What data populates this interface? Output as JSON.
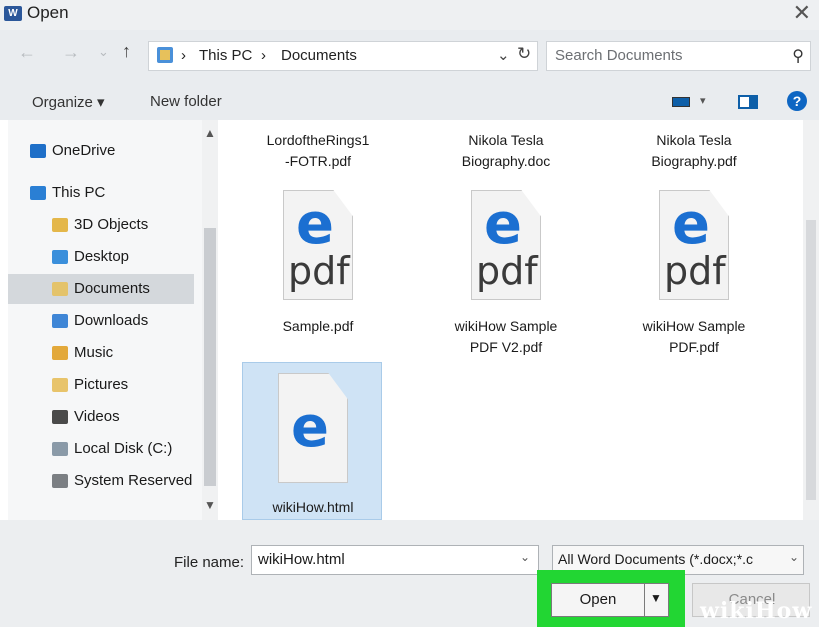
{
  "window": {
    "title": "Open",
    "close_glyph": "✕",
    "app_icon_text": "W"
  },
  "nav": {
    "back_glyph": "←",
    "forward_glyph": "→",
    "recent_glyph": "⌄",
    "up_glyph": "↑",
    "breadcrumb": [
      "›",
      "This PC",
      "›",
      "Documents"
    ],
    "dropdown_glyph": "⌄",
    "refresh_glyph": "↻",
    "search_placeholder": "Search Documents",
    "search_icon_glyph": "⚲"
  },
  "toolbar": {
    "organize_label": "Organize ▾",
    "new_folder_label": "New folder",
    "view_caret": "▾",
    "help_label": "?"
  },
  "sidebar": {
    "scroll_up": "▲",
    "scroll_down": "▼",
    "items": [
      {
        "label": "OneDrive",
        "icon": "cloud-icon",
        "color": "#1e6fc8",
        "selected": false
      },
      {
        "label": "This PC",
        "icon": "computer-icon",
        "color": "#2a7fd4",
        "selected": false
      },
      {
        "label": "3D Objects",
        "icon": "3d-objects-folder-icon",
        "color": "#e4b74a",
        "selected": false
      },
      {
        "label": "Desktop",
        "icon": "desktop-folder-icon",
        "color": "#3a8fdb",
        "selected": false
      },
      {
        "label": "Documents",
        "icon": "documents-folder-icon",
        "color": "#e4c36a",
        "selected": true
      },
      {
        "label": "Downloads",
        "icon": "downloads-folder-icon",
        "color": "#3f86d6",
        "selected": false
      },
      {
        "label": "Music",
        "icon": "music-folder-icon",
        "color": "#e3a93b",
        "selected": false
      },
      {
        "label": "Pictures",
        "icon": "pictures-folder-icon",
        "color": "#e8c46b",
        "selected": false
      },
      {
        "label": "Videos",
        "icon": "videos-folder-icon",
        "color": "#4a4a4a",
        "selected": false
      },
      {
        "label": "Local Disk (C:)",
        "icon": "drive-icon",
        "color": "#8a9aa8",
        "selected": false
      },
      {
        "label": "System Reserved",
        "icon": "drive-icon",
        "color": "#7b7f83",
        "selected": false
      }
    ]
  },
  "files": [
    {
      "name_lines": [
        "LordoftheRings1",
        "-FOTR.pdf"
      ],
      "icon": "edge-pdf-icon"
    },
    {
      "name_lines": [
        "Nikola Tesla",
        "Biography.doc"
      ],
      "icon": "edge-pdf-icon"
    },
    {
      "name_lines": [
        "Nikola Tesla",
        "Biography.pdf"
      ],
      "icon": "edge-pdf-icon"
    },
    {
      "name_lines": [
        "Sample.pdf"
      ],
      "icon": "edge-logo"
    },
    {
      "name_lines": [
        "wikiHow Sample",
        "PDF V2.pdf"
      ],
      "icon": "edge-logo"
    },
    {
      "name_lines": [
        "wikiHow Sample",
        "PDF.pdf"
      ],
      "icon": "edge-logo"
    },
    {
      "name_lines": [
        "wikiHow.html"
      ],
      "icon": "edge-html-icon",
      "selected": true
    }
  ],
  "icon_text": {
    "e": "e",
    "pdf": "pdf"
  },
  "bottom": {
    "file_name_label": "File name:",
    "file_name_value": "wikiHow.html",
    "file_name_chev": "⌄",
    "filter_value": "All Word Documents (*.docx;*.c",
    "filter_chev": "⌄",
    "open_label": "Open",
    "open_caret": "▼",
    "cancel_label": "Cancel"
  },
  "watermark": "wikiHow",
  "colors": {
    "highlight": "#22d633",
    "accent": "#1b6fd1",
    "selection": "#cfe3f5"
  }
}
